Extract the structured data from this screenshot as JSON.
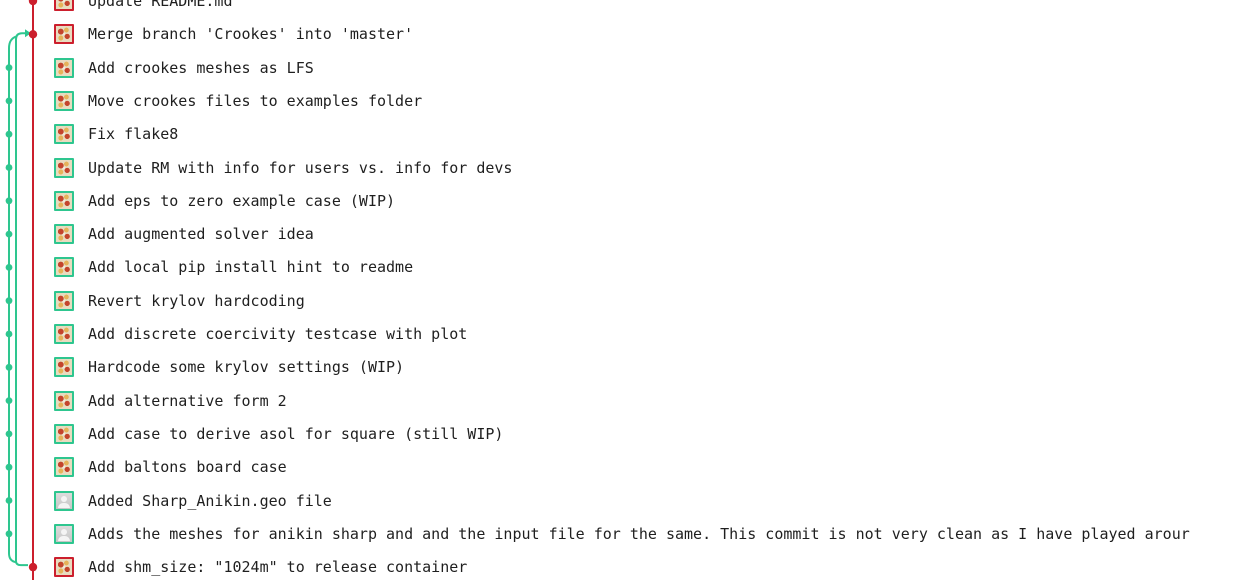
{
  "colors": {
    "master_branch": "#cc1f2d",
    "feature_branch": "#2ec68f"
  },
  "commits": [
    {
      "message": "Update README.md",
      "avatar": "pixel-avatar",
      "branch": "master"
    },
    {
      "message": "Merge branch 'Crookes' into 'master'",
      "avatar": "pixel-avatar",
      "branch": "master"
    },
    {
      "message": "Add crookes meshes as LFS",
      "avatar": "pixel-avatar",
      "branch": "feature"
    },
    {
      "message": "Move crookes files to examples folder",
      "avatar": "pixel-avatar",
      "branch": "feature"
    },
    {
      "message": "Fix flake8",
      "avatar": "pixel-avatar",
      "branch": "feature"
    },
    {
      "message": "Update RM with info for users vs. info for devs",
      "avatar": "pixel-avatar",
      "branch": "feature"
    },
    {
      "message": "Add eps to zero example case (WIP)",
      "avatar": "pixel-avatar",
      "branch": "feature"
    },
    {
      "message": "Add augmented solver idea",
      "avatar": "pixel-avatar",
      "branch": "feature"
    },
    {
      "message": "Add local pip install hint to readme",
      "avatar": "pixel-avatar",
      "branch": "feature"
    },
    {
      "message": "Revert krylov hardcoding",
      "avatar": "pixel-avatar",
      "branch": "feature"
    },
    {
      "message": "Add discrete coercivity testcase with plot",
      "avatar": "pixel-avatar",
      "branch": "feature"
    },
    {
      "message": "Hardcode some krylov settings (WIP)",
      "avatar": "pixel-avatar",
      "branch": "feature"
    },
    {
      "message": "Add alternative form 2",
      "avatar": "pixel-avatar",
      "branch": "feature"
    },
    {
      "message": "Add case to derive asol for square (still WIP)",
      "avatar": "pixel-avatar",
      "branch": "feature"
    },
    {
      "message": "Add baltons board case",
      "avatar": "pixel-avatar",
      "branch": "feature"
    },
    {
      "message": "Added Sharp_Anikin.geo file",
      "avatar": "default-user-icon",
      "branch": "feature"
    },
    {
      "message": "Adds the meshes for anikin sharp and and the input file for the same. This commit is not very clean as I have played arour",
      "avatar": "default-user-icon",
      "branch": "feature"
    },
    {
      "message": "Add shm_size: \"1024m\" to release container",
      "avatar": "pixel-avatar",
      "branch": "master"
    }
  ]
}
